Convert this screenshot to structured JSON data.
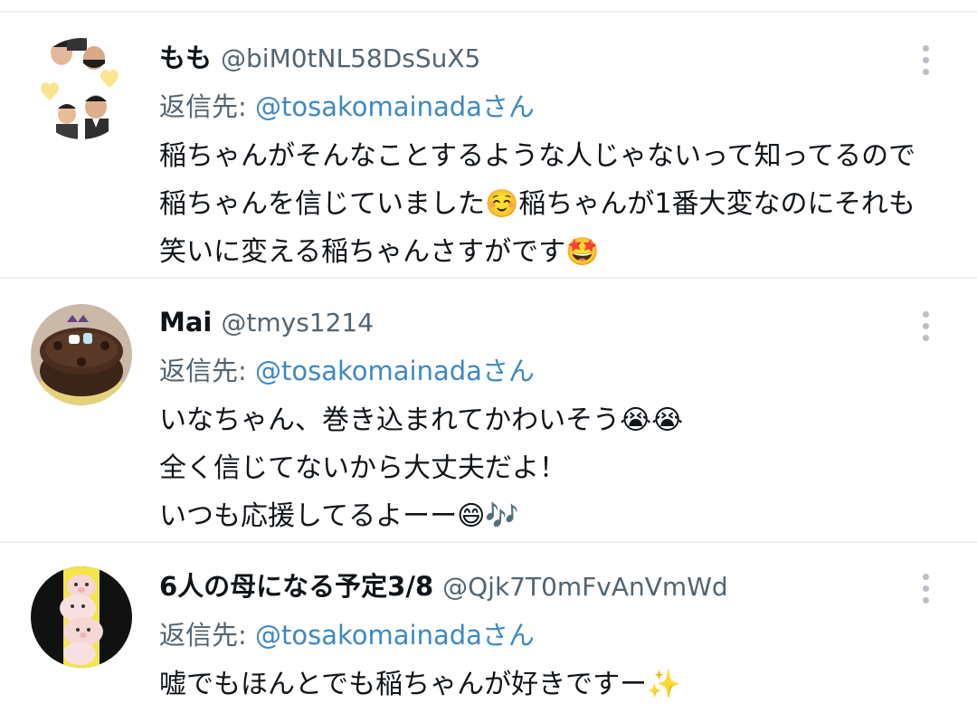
{
  "replies": [
    {
      "display_name": "もも",
      "handle": "@biM0tNL58DsSuX5",
      "reply_to_label": "返信先:",
      "reply_to_mention": "@tosakomainada",
      "reply_to_suffix": "さん",
      "text_lines": [
        "稲ちゃんがそんなことするような人じゃないって知ってるので",
        "稲ちゃんを信じていました☺️稲ちゃんが1番大変なのにそれも",
        "笑いに変える稲ちゃんさすがです🤩"
      ],
      "avatar_icon": "avatar-photo-two-men-icon",
      "menu_icon": "more-vertical-icon"
    },
    {
      "display_name": "Mai",
      "handle": "@tmys1214",
      "reply_to_label": "返信先:",
      "reply_to_mention": "@tosakomainada",
      "reply_to_suffix": "さん",
      "text_lines": [
        "いなちゃん、巻き込まれてかわいそう😭😭",
        "全く信じてないから大丈夫だよ！",
        "いつも応援してるよーー😄🎶"
      ],
      "avatar_icon": "avatar-chocolate-cake-icon",
      "menu_icon": "more-vertical-icon"
    },
    {
      "display_name": "6人の母になる予定3/8",
      "handle": "@Qjk7T0mFvAnVmWd",
      "reply_to_label": "返信先:",
      "reply_to_mention": "@tosakomainada",
      "reply_to_suffix": "さん",
      "text_lines": [
        "嘘でもほんとでも稲ちゃんが好きですー✨"
      ],
      "avatar_icon": "avatar-cartoon-pigs-icon",
      "menu_icon": "more-vertical-icon"
    }
  ],
  "colors": {
    "text_primary": "#0f1419",
    "text_secondary": "#536471",
    "mention": "#3e88c4",
    "divider": "#eceff1",
    "menu_dots": "#b9c0c6"
  }
}
